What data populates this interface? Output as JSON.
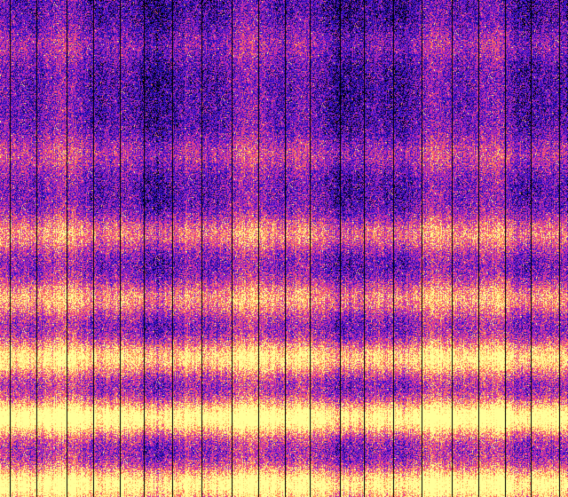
{
  "colormap": {
    "name": "plasma-like",
    "stops": [
      "#000000",
      "#1a0a8a",
      "#2b0fd0",
      "#7a1fc8",
      "#c02ab8",
      "#f0408a",
      "#ff7a4a",
      "#ffd070",
      "#ffff9a"
    ]
  },
  "bands": [
    {
      "center": 0.09,
      "strength": 0.14
    },
    {
      "center": 0.31,
      "strength": 0.2
    },
    {
      "center": 0.47,
      "strength": 0.38
    },
    {
      "center": 0.6,
      "strength": 0.42
    },
    {
      "center": 0.72,
      "strength": 0.6
    },
    {
      "center": 0.84,
      "strength": 0.78
    },
    {
      "center": 0.975,
      "strength": 0.7
    }
  ],
  "background_level": 0.26,
  "divider_color": "#000000",
  "divider_count": 21
}
